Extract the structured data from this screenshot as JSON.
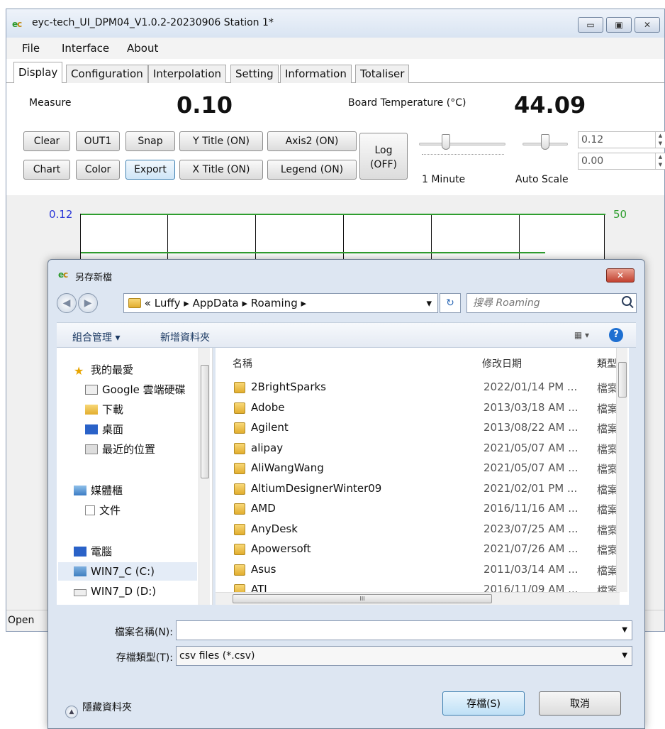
{
  "window": {
    "title": "eyc-tech_UI_DPM04_V1.0.2-20230906  Station 1*",
    "logo_e": "e",
    "logo_c": "c",
    "minimize_glyph": "▭",
    "maximize_glyph": "▣",
    "close_glyph": "✕"
  },
  "menu": {
    "items": [
      "File",
      "Interface",
      "About"
    ]
  },
  "tabs": [
    "Display",
    "Configuration",
    "Interpolation",
    "Setting",
    "Information",
    "Totaliser"
  ],
  "display": {
    "measure_label": "Measure",
    "measure_value": "0.10",
    "temp_label": "Board Temperature (°C)",
    "temp_value": "44.09",
    "buttons": {
      "clear": "Clear",
      "out1": "OUT1",
      "snap": "Snap",
      "ytitle": "Y Title (ON)",
      "axis2": "Axis2 (ON)",
      "log": "Log (OFF)",
      "chart": "Chart",
      "color": "Color",
      "export": "Export",
      "xtitle": "X Title (ON)",
      "legend": "Legend (ON)"
    },
    "time_slider_label": "1 Minute",
    "scale_slider_label": "Auto Scale",
    "spin_max": "0.12",
    "spin_min": "0.00",
    "spin_up": "▲",
    "spin_down": "▼"
  },
  "chart": {
    "y_left_top": "0.12",
    "y_right_top": "50",
    "series_color": "#2f9e2f"
  },
  "status": {
    "text": "Open"
  },
  "dialog": {
    "title": "另存新檔",
    "close_glyph": "✕",
    "nav_back": "◀",
    "nav_forward": "▶",
    "breadcrumb": "« Luffy ▸ AppData ▸ Roaming ▸",
    "addr_dropdown": "▾",
    "refresh_glyph": "↻",
    "search_placeholder": "搜尋 Roaming",
    "organize": "組合管理 ▾",
    "new_folder": "新增資料夾",
    "view_glyph": "▦ ▾",
    "help_glyph": "?",
    "nav_items": [
      {
        "label": "我的最愛"
      },
      {
        "label": "Google 雲端硬碟"
      },
      {
        "label": "下載"
      },
      {
        "label": "桌面"
      },
      {
        "label": "最近的位置"
      },
      {
        "label": "媒體櫃"
      },
      {
        "label": "文件"
      },
      {
        "label": "電腦"
      },
      {
        "label": "WIN7_C (C:)"
      },
      {
        "label": "WIN7_D (D:)"
      }
    ],
    "columns": {
      "name": "名稱",
      "date": "修改日期",
      "type": "類型"
    },
    "files": [
      {
        "name": "2BrightSparks",
        "date": "2022/01/14 PM ...",
        "type": "檔案資料夾"
      },
      {
        "name": "Adobe",
        "date": "2013/03/18 AM ...",
        "type": "檔案資料夾"
      },
      {
        "name": "Agilent",
        "date": "2013/08/22 AM ...",
        "type": "檔案資料夾"
      },
      {
        "name": "alipay",
        "date": "2021/05/07 AM ...",
        "type": "檔案資料夾"
      },
      {
        "name": "AliWangWang",
        "date": "2021/05/07 AM ...",
        "type": "檔案資料夾"
      },
      {
        "name": "AltiumDesignerWinter09",
        "date": "2021/02/01 PM ...",
        "type": "檔案資料夾"
      },
      {
        "name": "AMD",
        "date": "2016/11/16 AM ...",
        "type": "檔案資料夾"
      },
      {
        "name": "AnyDesk",
        "date": "2023/07/25 AM ...",
        "type": "檔案資料夾"
      },
      {
        "name": "Apowersoft",
        "date": "2021/07/26 AM ...",
        "type": "檔案資料夾"
      },
      {
        "name": "Asus",
        "date": "2011/03/14 AM ...",
        "type": "檔案資料夾"
      },
      {
        "name": "ATI",
        "date": "2016/11/09 AM ...",
        "type": "檔案資料夾"
      }
    ],
    "scroll_grip": "III",
    "filename_label": "檔案名稱(N):",
    "filename_value": "",
    "filetype_label": "存檔類型(T):",
    "filetype_value": "csv files (*.csv)",
    "dropdown_arrow": "▼",
    "hide_folders": "隱藏資料夾",
    "hide_folders_glyph": "▲",
    "save_button": "存檔(S)",
    "cancel_button": "取消"
  }
}
